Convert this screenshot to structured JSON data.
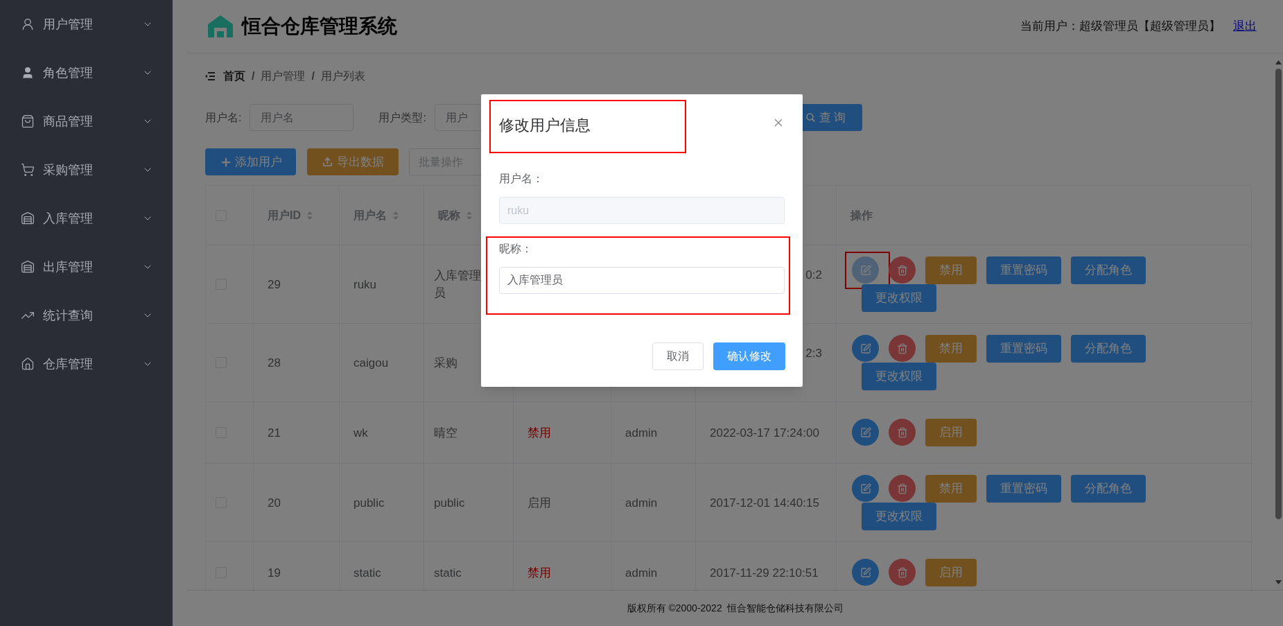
{
  "sidebar": {
    "items": [
      {
        "label": "用户管理"
      },
      {
        "label": "角色管理"
      },
      {
        "label": "商品管理"
      },
      {
        "label": "采购管理"
      },
      {
        "label": "入库管理"
      },
      {
        "label": "出库管理"
      },
      {
        "label": "统计查询"
      },
      {
        "label": "仓库管理"
      }
    ]
  },
  "header": {
    "title": "恒合仓库管理系统",
    "user_label": "当前用户：超级管理员【超级管理员】",
    "logout": "退出"
  },
  "breadcrumb": [
    {
      "label": "首页"
    },
    {
      "separator": "/",
      "label": "用户管理"
    },
    {
      "separator": "/",
      "label": "用户列表"
    }
  ],
  "search": {
    "fields": [
      {
        "label": "用户名:",
        "placeholder": "用户名"
      },
      {
        "label": "用户类型:",
        "placeholder": "用户"
      }
    ],
    "query_button": "查 询"
  },
  "toolbar": {
    "add": "添加用户",
    "export": "导出数据",
    "batch": "批量操作"
  },
  "table": {
    "header_checked": false,
    "columns": [
      {
        "label": "用户ID",
        "sortable": true
      },
      {
        "label": "用户名",
        "sortable": true
      },
      {
        "label": "昵称",
        "sortable": true
      },
      {
        "label": "操作",
        "sortable": false
      }
    ],
    "rows": [
      {
        "checked": false,
        "id": "29",
        "username": "ruku",
        "nickname": "入库管理员",
        "time": "0:2",
        "time_clipped": true,
        "actions": [
          {
            "kind": "edit",
            "hovered": true,
            "highlighted": true
          },
          {
            "kind": "delete"
          },
          {
            "kind": "warning",
            "label": "禁用"
          },
          {
            "kind": "primary",
            "label": "重置密码"
          },
          {
            "kind": "primary",
            "label": "分配角色"
          },
          {
            "kind": "primary",
            "label": "更改权限"
          }
        ]
      },
      {
        "checked": false,
        "id": "28",
        "username": "caigou",
        "nickname": "采购",
        "time": "2:3",
        "time_clipped": true,
        "actions": [
          {
            "kind": "edit",
            "hovered": false,
            "highlighted": false
          },
          {
            "kind": "delete"
          },
          {
            "kind": "warning",
            "label": "禁用"
          },
          {
            "kind": "primary",
            "label": "重置密码"
          },
          {
            "kind": "primary",
            "label": "分配角色"
          },
          {
            "kind": "primary",
            "label": "更改权限"
          }
        ]
      },
      {
        "checked": false,
        "id": "21",
        "username": "wk",
        "nickname": "晴空",
        "status": {
          "text": "禁用",
          "kind": "disabled"
        },
        "creator": "admin",
        "time": "2022-03-17 17:24:00",
        "time_clipped": false,
        "actions": [
          {
            "kind": "edit",
            "hovered": false,
            "highlighted": false
          },
          {
            "kind": "delete"
          },
          {
            "kind": "warning",
            "label": "启用"
          }
        ]
      },
      {
        "checked": false,
        "id": "20",
        "username": "public",
        "nickname": "public",
        "status": {
          "text": "启用",
          "kind": "enabled"
        },
        "creator": "admin",
        "time": "2017-12-01 14:40:15",
        "time_clipped": false,
        "actions": [
          {
            "kind": "edit",
            "hovered": false,
            "highlighted": false
          },
          {
            "kind": "delete"
          },
          {
            "kind": "warning",
            "label": "禁用"
          },
          {
            "kind": "primary",
            "label": "重置密码"
          },
          {
            "kind": "primary",
            "label": "分配角色"
          },
          {
            "kind": "primary",
            "label": "更改权限"
          }
        ]
      },
      {
        "checked": false,
        "id": "19",
        "username": "static",
        "nickname": "static",
        "status": {
          "text": "禁用",
          "kind": "disabled"
        },
        "creator": "admin",
        "time": "2017-11-29 22:10:51",
        "time_clipped": false,
        "actions": [
          {
            "kind": "edit",
            "hovered": false,
            "highlighted": false
          },
          {
            "kind": "delete"
          },
          {
            "kind": "warning",
            "label": "启用"
          }
        ]
      }
    ]
  },
  "footer": "版权所有 ©2000-2022  恒合智能仓储科技有限公司",
  "modal": {
    "title": {
      "text": "修改用户信息",
      "highlighted": true
    },
    "fields": [
      {
        "label": "用户名：",
        "value": "ruku",
        "disabled": true,
        "highlighted": false
      },
      {
        "label": "昵称：",
        "value": "入库管理员",
        "disabled": false,
        "highlighted": true
      }
    ],
    "buttons": [
      {
        "label": "取消",
        "kind": "default"
      },
      {
        "label": "确认修改",
        "kind": "primary"
      }
    ]
  }
}
